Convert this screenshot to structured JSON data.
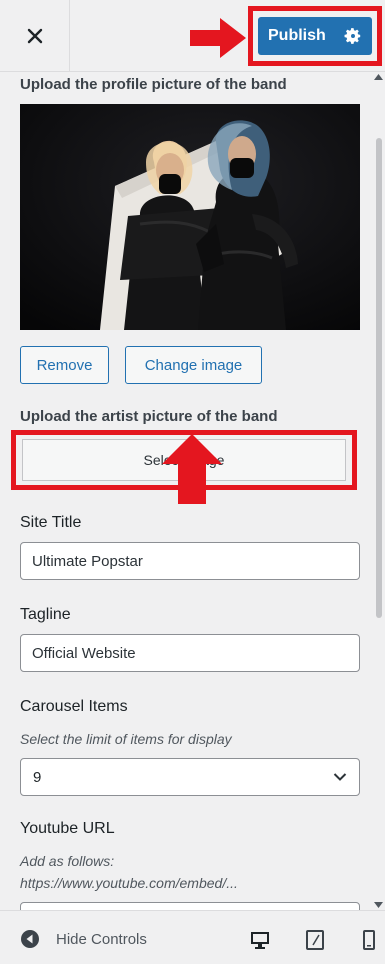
{
  "topbar": {
    "publish_label": "Publish"
  },
  "sections": {
    "profile_picture_label": "Upload the profile picture of the band",
    "remove_label": "Remove",
    "change_image_label": "Change image",
    "artist_picture_label": "Upload the artist picture of the band",
    "select_image_label": "Select image",
    "site_title_label": "Site Title",
    "site_title_value": "Ultimate Popstar",
    "tagline_label": "Tagline",
    "tagline_value": "Official Website",
    "carousel_label": "Carousel Items",
    "carousel_desc": "Select the limit of items for display",
    "carousel_value": "9",
    "youtube_label": "Youtube URL",
    "youtube_desc_1": "Add as follows:",
    "youtube_desc_2": "https://www.youtube.com/embed/..."
  },
  "footer": {
    "hide_controls_label": "Hide Controls"
  },
  "colors": {
    "accent": "#2271b1",
    "highlight_red": "#e4161f"
  },
  "icons": {
    "close": "close-icon",
    "settings": "gear-icon",
    "collapse": "collapse-icon",
    "desktop": "desktop-icon",
    "tablet": "tablet-icon",
    "mobile": "mobile-icon"
  }
}
